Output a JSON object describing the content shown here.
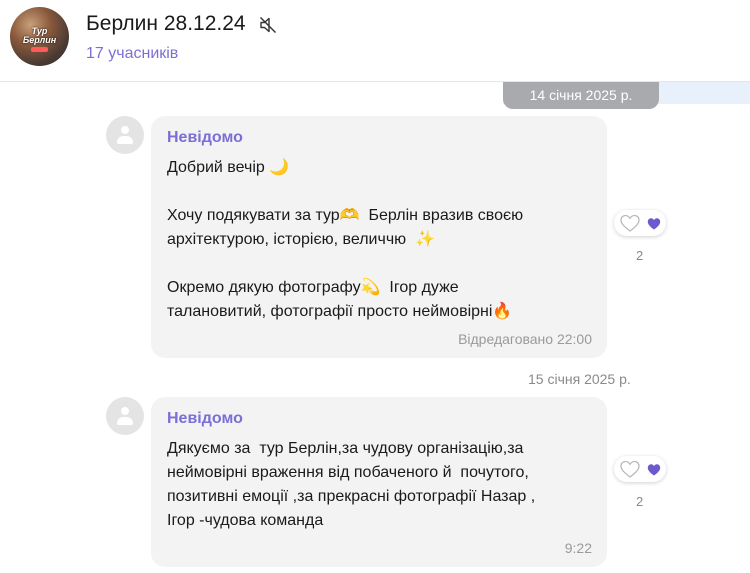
{
  "header": {
    "avatar_text_top": "Тур",
    "avatar_text_bottom": "Берлин",
    "title": "Берлин 28.12.24",
    "members": "17 учасників"
  },
  "date_separators": [
    "14 січня 2025 р.",
    "15 січня 2025 р."
  ],
  "messages": [
    {
      "sender": "Невідомо",
      "text": "Добрий вечір 🌙\n\nХочу подякувати за тур🫶  Берлін вразив своєю\nархітектурою, історією, величчю  ✨\n\nОкремо дякую фотографу💫  Ігор дуже\nталановитий, фотографії просто неймовірні🔥",
      "meta": "Відредаговано 22:00",
      "reaction_count": "2"
    },
    {
      "sender": "Невідомо",
      "text": "Дякуємо за  тур Берлін,за чудову організацію,за\nнеймовірні враження від побаченого й  почутого,\nпозитивні емоції ,за прекрасні фотографії Назар ,\nІгор -чудова команда",
      "meta": "9:22",
      "reaction_count": "2"
    }
  ],
  "colors": {
    "accent": "#7b6fd6",
    "bubble": "#f3f3f4",
    "date_pill": "#a8aaad",
    "reaction_heart": "#6a5acd"
  },
  "icons": [
    "mute-icon",
    "user-placeholder-icon",
    "heart-outline-icon",
    "heart-filled-icon"
  ]
}
